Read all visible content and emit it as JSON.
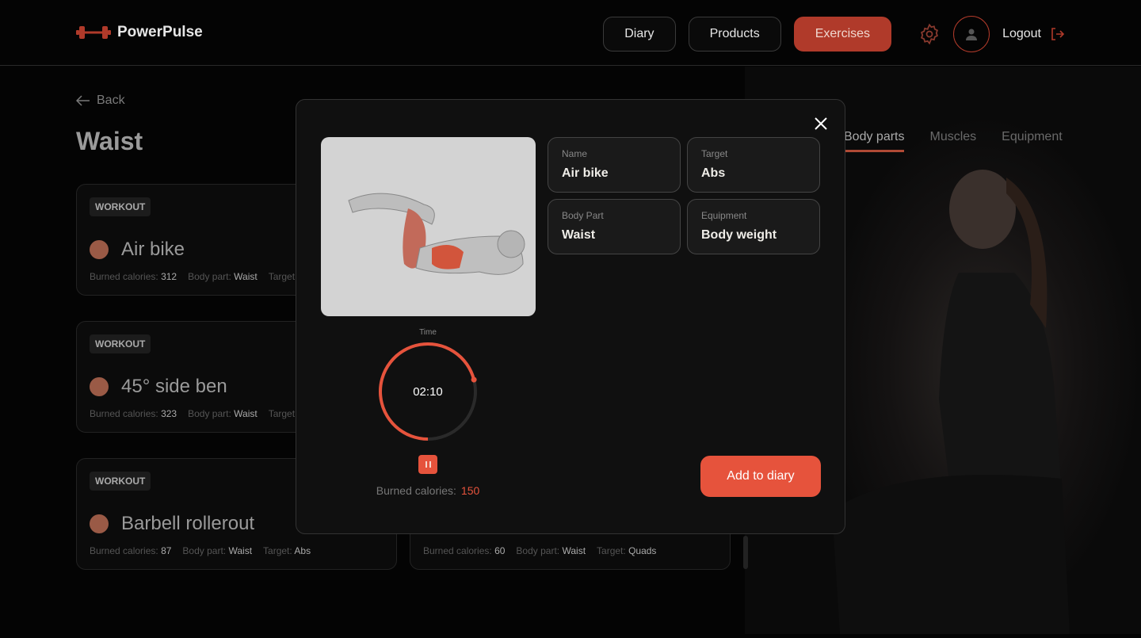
{
  "app": {
    "name": "PowerPulse",
    "accent": "#e6533c"
  },
  "nav": {
    "items": [
      {
        "label": "Diary"
      },
      {
        "label": "Products"
      },
      {
        "label": "Exercises",
        "active": true
      }
    ],
    "logout": "Logout"
  },
  "page": {
    "back": "Back",
    "title": "Waist",
    "tabs": [
      {
        "label": "Body parts",
        "active": true
      },
      {
        "label": "Muscles"
      },
      {
        "label": "Equipment"
      }
    ]
  },
  "labels": {
    "burned": "Burned calories:",
    "body_part": "Body part:",
    "target": "Target:"
  },
  "cards": [
    {
      "badge": "WORKOUT",
      "name": "Air bike",
      "calories": "312",
      "body_part": "Waist",
      "target": ""
    },
    {
      "badge": "WORKOUT",
      "name": "45° side ben",
      "calories": "323",
      "body_part": "Waist",
      "target": ""
    },
    {
      "badge": "WORKOUT",
      "name": "Barbell rollerout",
      "calories": "87",
      "body_part": "Waist",
      "target": "Abs"
    },
    {
      "calories": "60",
      "body_part": "Waist",
      "target": "Quads"
    }
  ],
  "modal": {
    "fields": [
      {
        "label": "Name",
        "value": "Air bike"
      },
      {
        "label": "Target",
        "value": "Abs"
      },
      {
        "label": "Body Part",
        "value": "Waist"
      },
      {
        "label": "Equipment",
        "value": "Body weight"
      }
    ],
    "time_label": "Time",
    "time": "02:10",
    "timer_progress": 0.71,
    "burned_label": "Burned calories:",
    "burned_value": "150",
    "add_button": "Add to diary"
  }
}
